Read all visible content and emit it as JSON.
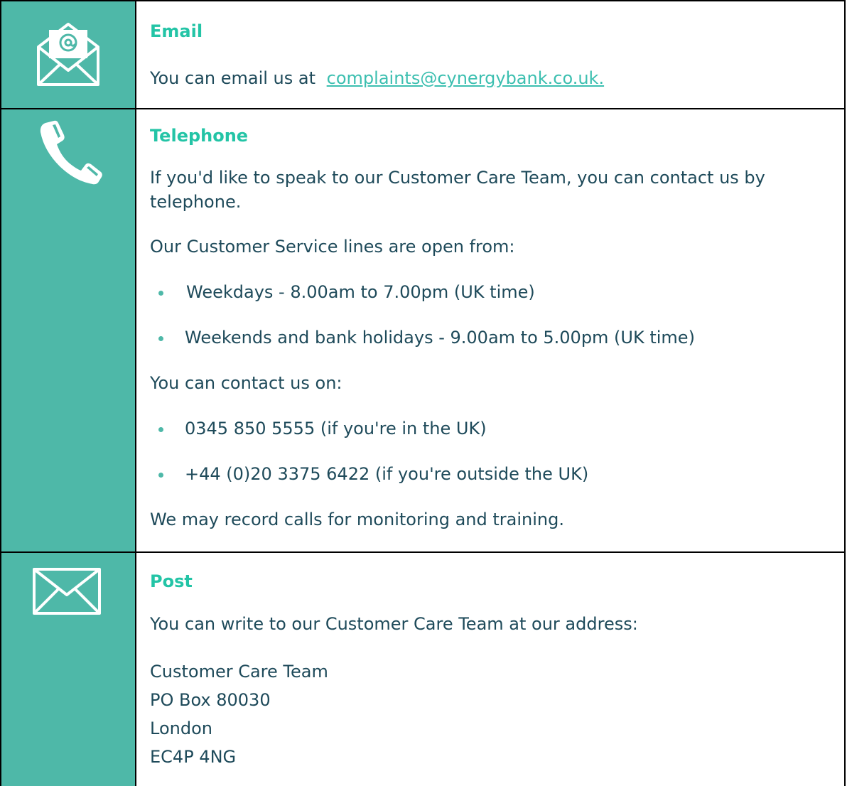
{
  "email": {
    "heading": "Email",
    "text_prefix": "You can email us at",
    "link": "complaints@cynergybank.co.uk."
  },
  "telephone": {
    "heading": "Telephone",
    "intro": "If you'd like to speak to our Customer Care Team, you can contact us by telephone.",
    "hours_intro": "Our Customer Service lines are open from:",
    "hours": [
      "Weekdays - 8.00am to  7.00pm (UK time)",
      "Weekends and bank holidays - 9.00am to 5.00pm (UK time)"
    ],
    "numbers_intro": "You can contact us on:",
    "numbers": [
      "0345 850 5555 (if you're in the UK)",
      "+44 (0)20 3375 6422 (if you're outside the UK)"
    ],
    "note": "We may record calls for monitoring and training."
  },
  "post": {
    "heading": "Post",
    "intro": "You can write to our Customer Care Team at our address:",
    "address": [
      "Customer Care Team",
      "PO Box 80030",
      "London",
      "EC4P 4NG"
    ]
  },
  "colors": {
    "icon_column": "#4eb8a8",
    "heading": "#23c4a6",
    "body_text": "#1e4a5a",
    "link": "#3cbfb0"
  },
  "icons": {
    "email": "email-open-icon",
    "telephone": "telephone-icon",
    "post": "envelope-icon"
  }
}
